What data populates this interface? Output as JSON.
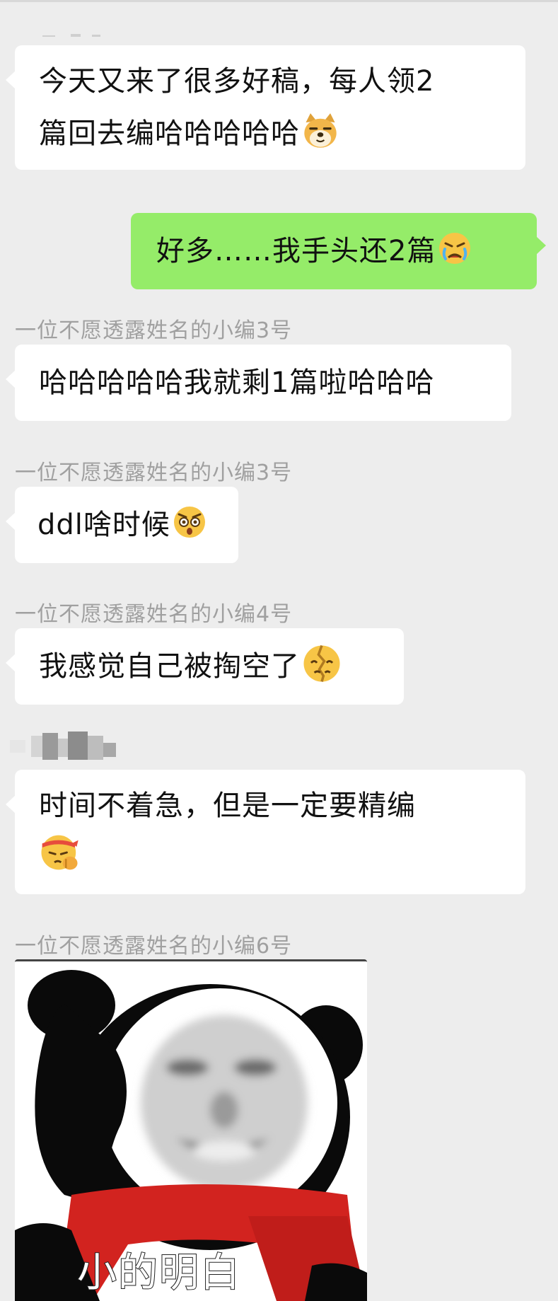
{
  "messages": [
    {
      "text": "今天又来了很多好稿，每人领2",
      "text2": "篇回去编哈哈哈哈哈",
      "emoji": "doge-emoji"
    },
    {
      "text": "好多……我手头还2篇",
      "emoji": "crying-angry-emoji"
    },
    {
      "sender": "一位不愿透露姓名的小编3号",
      "text": "哈哈哈哈哈我就剩1篇啦哈哈哈"
    },
    {
      "sender": "一位不愿透露姓名的小编3号",
      "text": "ddl啥时候",
      "emoji": "wide-eyed-emoji"
    },
    {
      "sender": "一位不愿透露姓名的小编4号",
      "text": "我感觉自己被掏空了",
      "emoji": "broken-face-emoji"
    },
    {
      "text": "时间不着急，但是一定要精编",
      "emoji": "headband-salute-emoji"
    },
    {
      "sender": "一位不愿透露姓名的小编6号",
      "sticker_caption": "小的明白"
    }
  ],
  "colors": {
    "background": "#ededed",
    "incoming_bubble": "#ffffff",
    "outgoing_bubble": "#95ec69",
    "sender_text": "#a0a0a0"
  }
}
